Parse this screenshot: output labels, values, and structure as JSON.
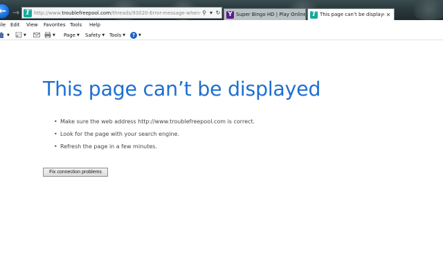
{
  "window": {
    "back_glyph": "←",
    "forward_glyph": "→",
    "address_bar": {
      "favicon_letter": "T",
      "url_prefix": "http://www.",
      "url_host": "troublefreepool.com",
      "url_path": "/threads/93020-Error-message-when-I-e",
      "search_glyph": "⚲",
      "dropdown_glyph": "▾",
      "refresh_glyph": "↻"
    },
    "tabs": [
      {
        "icon_letter": "Y",
        "label": "Super Bingo HD | Play Online -...",
        "active": false
      },
      {
        "icon_letter": "T",
        "label": "This page can’t be displayed",
        "active": true,
        "close_glyph": "✕"
      }
    ]
  },
  "menu": [
    "ile",
    "Edit",
    "View",
    "Favorites",
    "Tools",
    "Help"
  ],
  "command_bar": {
    "page_label": "Page",
    "safety_label": "Safety",
    "tools_label": "Tools",
    "help_glyph": "?",
    "caret": "▼"
  },
  "content": {
    "title": "This page can’t be displayed",
    "tips": [
      "Make sure the web address http://www.troublefreepool.com is correct.",
      "Look for the page with your search engine.",
      "Refresh the page in a few minutes."
    ],
    "fix_button": "Fix connection problems"
  },
  "colors": {
    "title_blue": "#1e6fd2",
    "chrome_dark": "#2a3a3e",
    "back_blue": "#1b6fd6"
  },
  "icons": {
    "back": "back-arrow-icon",
    "forward": "forward-arrow-icon",
    "home": "home-icon",
    "rss": "rss-feed-icon",
    "mail": "mail-icon",
    "print": "print-icon",
    "help": "help-icon"
  }
}
